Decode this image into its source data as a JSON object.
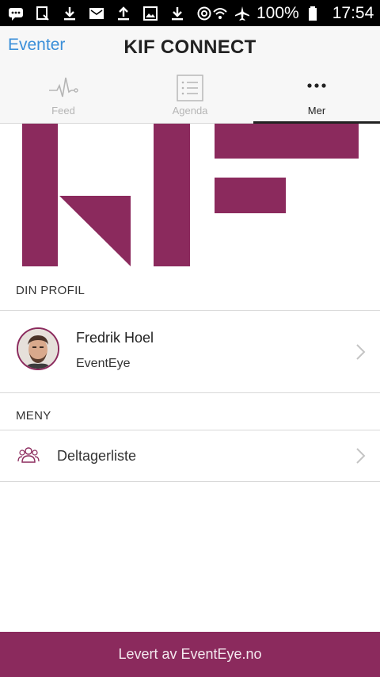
{
  "status_bar": {
    "battery_percent": "100%",
    "time": "17:54",
    "left_icons": [
      "chat-icon",
      "clipboard-icon",
      "download-icon",
      "mail-icon",
      "upload-icon",
      "image-icon",
      "download-icon",
      "sync-icon"
    ],
    "right_icons": [
      "wifi-icon",
      "airplane-icon",
      "battery-icon"
    ]
  },
  "header": {
    "back_label": "Eventer",
    "title": "KIF CONNECT"
  },
  "tabs": [
    {
      "label": "Feed",
      "icon": "pulse-icon",
      "active": false
    },
    {
      "label": "Agenda",
      "icon": "list-icon",
      "active": false
    },
    {
      "label": "Mer",
      "icon": "more-dots-icon",
      "active": true
    }
  ],
  "logo": {
    "name": "KIF logo",
    "color": "#8b2a5d"
  },
  "profile_section": {
    "header": "DIN PROFIL",
    "name": "Fredrik Hoel",
    "organization": "EventEye"
  },
  "menu_section": {
    "header": "MENY",
    "items": [
      {
        "label": "Deltagerliste",
        "icon": "participants-icon"
      }
    ]
  },
  "footer": {
    "label": "Levert av EventEye.no"
  },
  "colors": {
    "brand": "#8b2a5d",
    "link": "#3b8fd9",
    "tab_inactive": "#b5b5b5"
  }
}
